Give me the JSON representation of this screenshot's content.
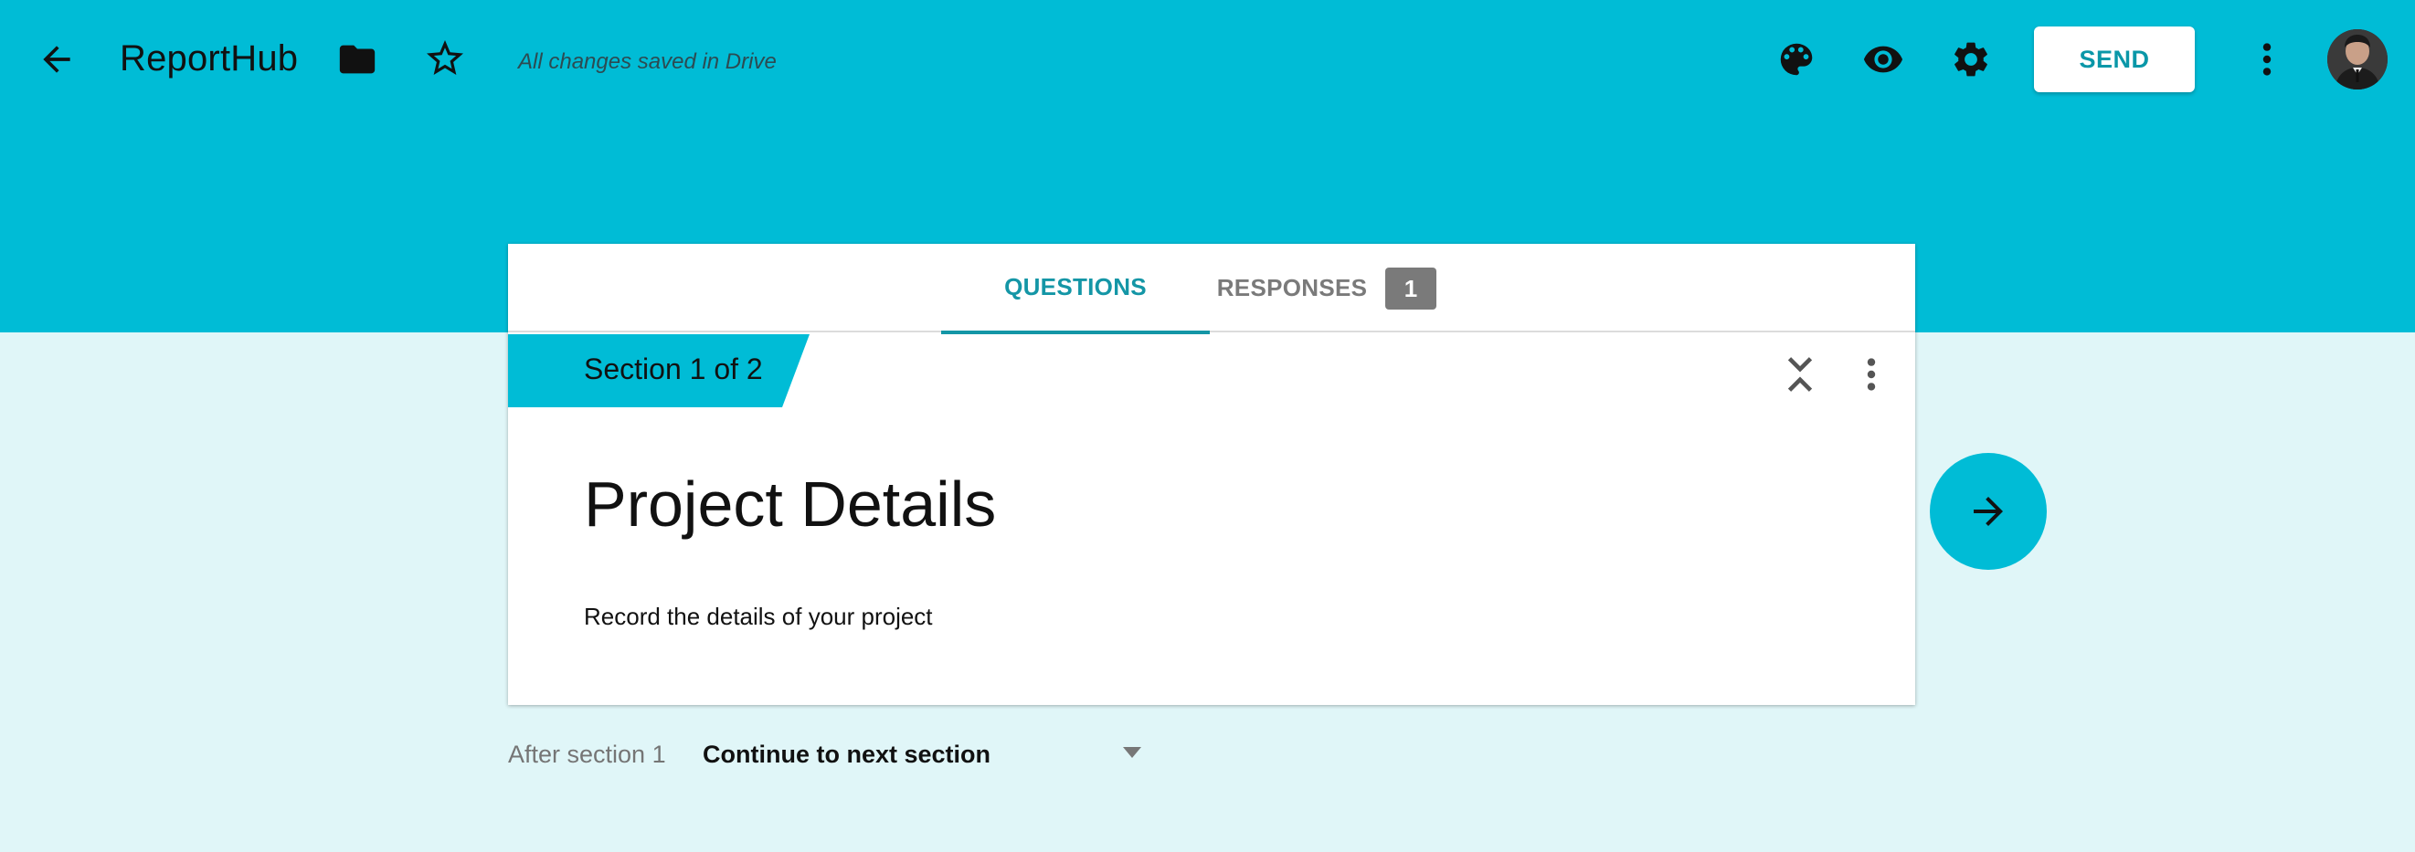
{
  "header": {
    "app_title": "ReportHub",
    "save_status": "All changes saved in Drive",
    "send_label": "SEND",
    "icons": [
      "back-icon",
      "folder-icon",
      "star-icon",
      "palette-icon",
      "eye-icon",
      "gear-icon",
      "more-vert-icon"
    ]
  },
  "tabs": {
    "questions_label": "QUESTIONS",
    "responses_label": "RESPONSES",
    "responses_count": "1"
  },
  "section": {
    "label": "Section 1 of 2",
    "title": "Project Details",
    "description": "Record the details of your project"
  },
  "after_section": {
    "label": "After section 1",
    "value": "Continue to next section"
  },
  "colors": {
    "header_bg": "#00bcd6",
    "page_bg": "#e0f6f8",
    "accent": "#1496a6",
    "badge_bg": "#7a7a7a"
  }
}
